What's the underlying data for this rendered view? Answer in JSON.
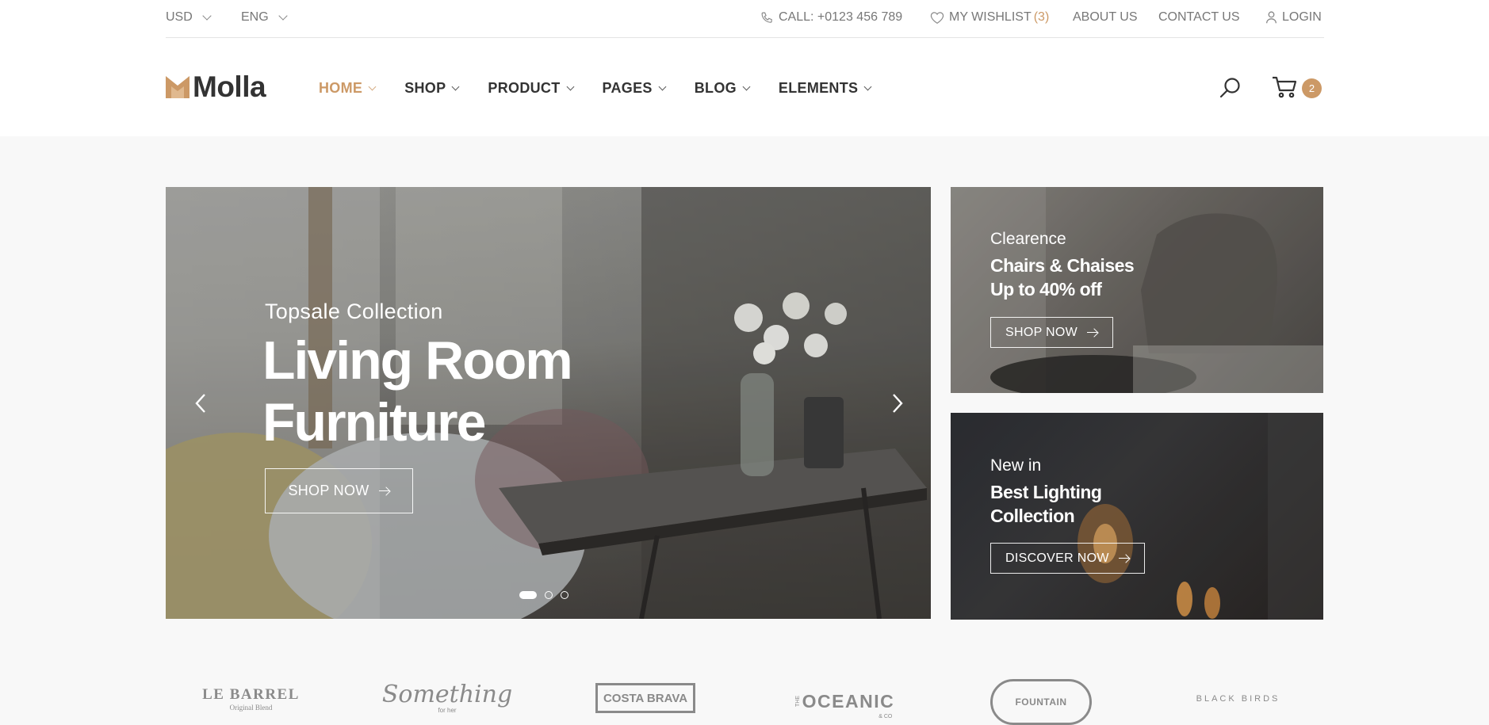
{
  "topbar": {
    "currency": "USD",
    "language": "ENG",
    "call": "CALL: +0123 456 789",
    "wishlist_label": "MY WISHLIST",
    "wishlist_count": "(3)",
    "about": "ABOUT US",
    "contact": "CONTACT US",
    "login": "LOGIN"
  },
  "header": {
    "logo": "Molla",
    "nav": [
      {
        "label": "HOME"
      },
      {
        "label": "SHOP"
      },
      {
        "label": "PRODUCT"
      },
      {
        "label": "PAGES"
      },
      {
        "label": "BLOG"
      },
      {
        "label": "ELEMENTS"
      }
    ],
    "cart_count": "2",
    "icons": {
      "search": "search-icon",
      "cart": "cart-icon"
    }
  },
  "hero": {
    "subtitle": "Topsale Collection",
    "title_line1": "Living Room",
    "title_line2": "Furniture",
    "button": "SHOP NOW",
    "slides": 3,
    "active_slide": 1
  },
  "banners": [
    {
      "subtitle": "Clearence",
      "title_line1": "Chairs & Chaises",
      "title_line2": "Up to 40% off",
      "button": "SHOP NOW"
    },
    {
      "subtitle": "New in",
      "title_line1": "Best Lighting",
      "title_line2": "Collection",
      "button": "DISCOVER NOW"
    }
  ],
  "brands": [
    {
      "name": "LE BARREL",
      "tagline": "Original Blend"
    },
    {
      "name": "Something",
      "tagline": "for her"
    },
    {
      "name": "COSTA BRAVA"
    },
    {
      "name": "OCEANIC",
      "prefix": "THE",
      "suffix": "& CO"
    },
    {
      "name": "FOUNTAIN"
    },
    {
      "name": "BLACK BIRDS"
    }
  ],
  "colors": {
    "accent": "#cc9966",
    "text": "#333333",
    "muted": "#777777"
  }
}
